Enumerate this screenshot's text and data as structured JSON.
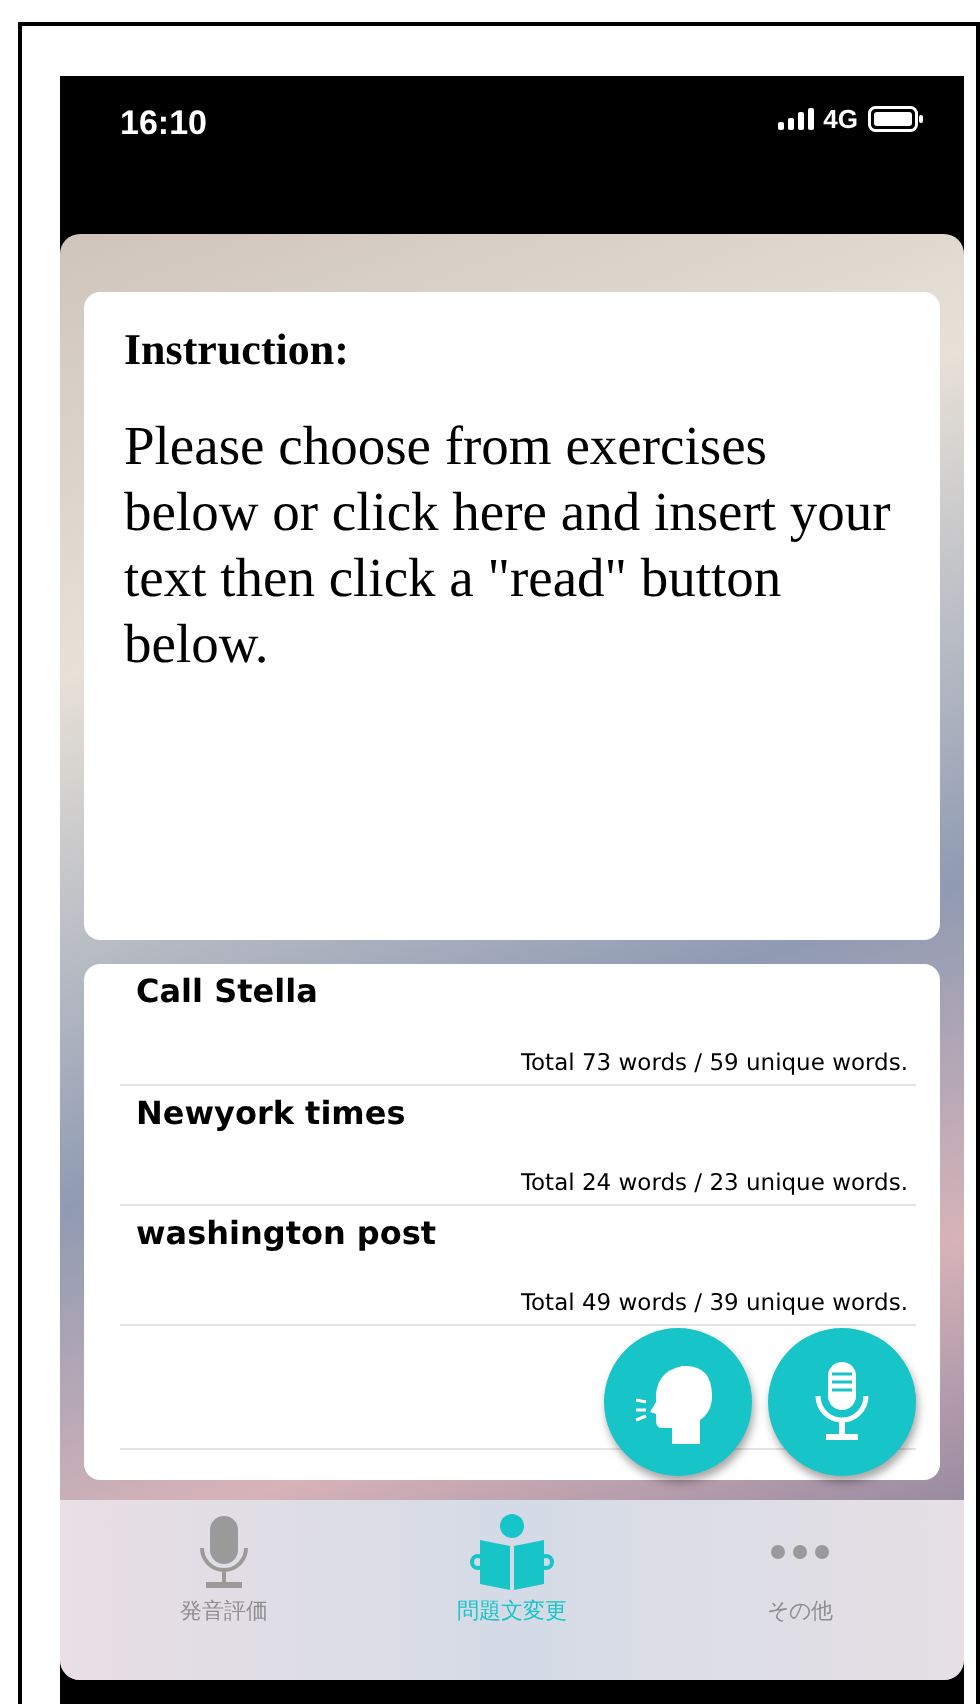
{
  "status_bar": {
    "time": "16:10",
    "network": "4G"
  },
  "instruction": {
    "title": "Instruction:",
    "text": "Please choose from exercises below or click here and insert your text then click a \"read\" button below."
  },
  "exercises": [
    {
      "title": "Call Stella",
      "stats": "Total 73 words / 59 unique words."
    },
    {
      "title": "Newyork times",
      "stats": "Total 24 words / 23 unique words."
    },
    {
      "title": "washington post",
      "stats": "Total 49 words / 39 unique words."
    }
  ],
  "actions": [
    {
      "kind": "speak"
    },
    {
      "kind": "record"
    }
  ],
  "tabs": [
    {
      "label": "発音評価",
      "kind": "mic",
      "selected": false
    },
    {
      "label": "問題文変更",
      "kind": "book",
      "selected": true
    },
    {
      "label": "その他",
      "kind": "more",
      "selected": false
    }
  ]
}
